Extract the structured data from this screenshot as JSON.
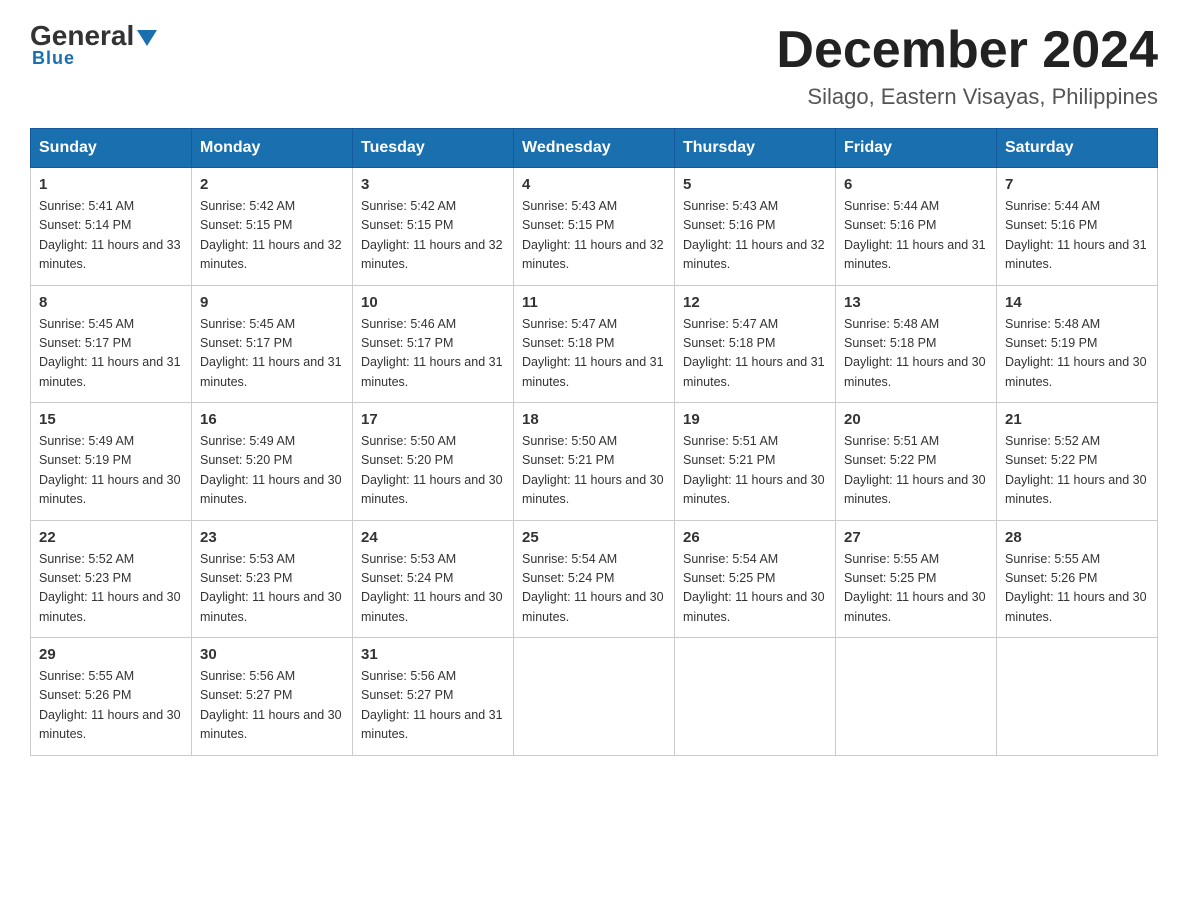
{
  "header": {
    "logo_general": "General",
    "logo_blue": "Blue",
    "month_title": "December 2024",
    "location": "Silago, Eastern Visayas, Philippines"
  },
  "days_of_week": [
    "Sunday",
    "Monday",
    "Tuesday",
    "Wednesday",
    "Thursday",
    "Friday",
    "Saturday"
  ],
  "weeks": [
    [
      {
        "day": "1",
        "sunrise": "Sunrise: 5:41 AM",
        "sunset": "Sunset: 5:14 PM",
        "daylight": "Daylight: 11 hours and 33 minutes."
      },
      {
        "day": "2",
        "sunrise": "Sunrise: 5:42 AM",
        "sunset": "Sunset: 5:15 PM",
        "daylight": "Daylight: 11 hours and 32 minutes."
      },
      {
        "day": "3",
        "sunrise": "Sunrise: 5:42 AM",
        "sunset": "Sunset: 5:15 PM",
        "daylight": "Daylight: 11 hours and 32 minutes."
      },
      {
        "day": "4",
        "sunrise": "Sunrise: 5:43 AM",
        "sunset": "Sunset: 5:15 PM",
        "daylight": "Daylight: 11 hours and 32 minutes."
      },
      {
        "day": "5",
        "sunrise": "Sunrise: 5:43 AM",
        "sunset": "Sunset: 5:16 PM",
        "daylight": "Daylight: 11 hours and 32 minutes."
      },
      {
        "day": "6",
        "sunrise": "Sunrise: 5:44 AM",
        "sunset": "Sunset: 5:16 PM",
        "daylight": "Daylight: 11 hours and 31 minutes."
      },
      {
        "day": "7",
        "sunrise": "Sunrise: 5:44 AM",
        "sunset": "Sunset: 5:16 PM",
        "daylight": "Daylight: 11 hours and 31 minutes."
      }
    ],
    [
      {
        "day": "8",
        "sunrise": "Sunrise: 5:45 AM",
        "sunset": "Sunset: 5:17 PM",
        "daylight": "Daylight: 11 hours and 31 minutes."
      },
      {
        "day": "9",
        "sunrise": "Sunrise: 5:45 AM",
        "sunset": "Sunset: 5:17 PM",
        "daylight": "Daylight: 11 hours and 31 minutes."
      },
      {
        "day": "10",
        "sunrise": "Sunrise: 5:46 AM",
        "sunset": "Sunset: 5:17 PM",
        "daylight": "Daylight: 11 hours and 31 minutes."
      },
      {
        "day": "11",
        "sunrise": "Sunrise: 5:47 AM",
        "sunset": "Sunset: 5:18 PM",
        "daylight": "Daylight: 11 hours and 31 minutes."
      },
      {
        "day": "12",
        "sunrise": "Sunrise: 5:47 AM",
        "sunset": "Sunset: 5:18 PM",
        "daylight": "Daylight: 11 hours and 31 minutes."
      },
      {
        "day": "13",
        "sunrise": "Sunrise: 5:48 AM",
        "sunset": "Sunset: 5:18 PM",
        "daylight": "Daylight: 11 hours and 30 minutes."
      },
      {
        "day": "14",
        "sunrise": "Sunrise: 5:48 AM",
        "sunset": "Sunset: 5:19 PM",
        "daylight": "Daylight: 11 hours and 30 minutes."
      }
    ],
    [
      {
        "day": "15",
        "sunrise": "Sunrise: 5:49 AM",
        "sunset": "Sunset: 5:19 PM",
        "daylight": "Daylight: 11 hours and 30 minutes."
      },
      {
        "day": "16",
        "sunrise": "Sunrise: 5:49 AM",
        "sunset": "Sunset: 5:20 PM",
        "daylight": "Daylight: 11 hours and 30 minutes."
      },
      {
        "day": "17",
        "sunrise": "Sunrise: 5:50 AM",
        "sunset": "Sunset: 5:20 PM",
        "daylight": "Daylight: 11 hours and 30 minutes."
      },
      {
        "day": "18",
        "sunrise": "Sunrise: 5:50 AM",
        "sunset": "Sunset: 5:21 PM",
        "daylight": "Daylight: 11 hours and 30 minutes."
      },
      {
        "day": "19",
        "sunrise": "Sunrise: 5:51 AM",
        "sunset": "Sunset: 5:21 PM",
        "daylight": "Daylight: 11 hours and 30 minutes."
      },
      {
        "day": "20",
        "sunrise": "Sunrise: 5:51 AM",
        "sunset": "Sunset: 5:22 PM",
        "daylight": "Daylight: 11 hours and 30 minutes."
      },
      {
        "day": "21",
        "sunrise": "Sunrise: 5:52 AM",
        "sunset": "Sunset: 5:22 PM",
        "daylight": "Daylight: 11 hours and 30 minutes."
      }
    ],
    [
      {
        "day": "22",
        "sunrise": "Sunrise: 5:52 AM",
        "sunset": "Sunset: 5:23 PM",
        "daylight": "Daylight: 11 hours and 30 minutes."
      },
      {
        "day": "23",
        "sunrise": "Sunrise: 5:53 AM",
        "sunset": "Sunset: 5:23 PM",
        "daylight": "Daylight: 11 hours and 30 minutes."
      },
      {
        "day": "24",
        "sunrise": "Sunrise: 5:53 AM",
        "sunset": "Sunset: 5:24 PM",
        "daylight": "Daylight: 11 hours and 30 minutes."
      },
      {
        "day": "25",
        "sunrise": "Sunrise: 5:54 AM",
        "sunset": "Sunset: 5:24 PM",
        "daylight": "Daylight: 11 hours and 30 minutes."
      },
      {
        "day": "26",
        "sunrise": "Sunrise: 5:54 AM",
        "sunset": "Sunset: 5:25 PM",
        "daylight": "Daylight: 11 hours and 30 minutes."
      },
      {
        "day": "27",
        "sunrise": "Sunrise: 5:55 AM",
        "sunset": "Sunset: 5:25 PM",
        "daylight": "Daylight: 11 hours and 30 minutes."
      },
      {
        "day": "28",
        "sunrise": "Sunrise: 5:55 AM",
        "sunset": "Sunset: 5:26 PM",
        "daylight": "Daylight: 11 hours and 30 minutes."
      }
    ],
    [
      {
        "day": "29",
        "sunrise": "Sunrise: 5:55 AM",
        "sunset": "Sunset: 5:26 PM",
        "daylight": "Daylight: 11 hours and 30 minutes."
      },
      {
        "day": "30",
        "sunrise": "Sunrise: 5:56 AM",
        "sunset": "Sunset: 5:27 PM",
        "daylight": "Daylight: 11 hours and 30 minutes."
      },
      {
        "day": "31",
        "sunrise": "Sunrise: 5:56 AM",
        "sunset": "Sunset: 5:27 PM",
        "daylight": "Daylight: 11 hours and 31 minutes."
      },
      {
        "day": "",
        "sunrise": "",
        "sunset": "",
        "daylight": ""
      },
      {
        "day": "",
        "sunrise": "",
        "sunset": "",
        "daylight": ""
      },
      {
        "day": "",
        "sunrise": "",
        "sunset": "",
        "daylight": ""
      },
      {
        "day": "",
        "sunrise": "",
        "sunset": "",
        "daylight": ""
      }
    ]
  ]
}
